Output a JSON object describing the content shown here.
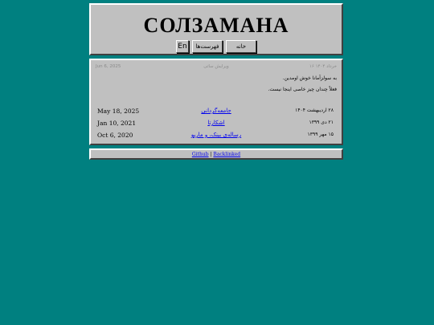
{
  "header": {
    "title": "СОЛЗАМАНА",
    "nav": {
      "lang_label": "En",
      "lists_label": "فهرست‌ها",
      "home_label": "خانه"
    }
  },
  "content": {
    "meta": {
      "date_en": "Jun 6, 2025",
      "edited_label": "ویرایش ساتی",
      "date_fa": "۱۶ خرداد ۱۴۰۴"
    },
    "intro": [
      "به سولزآمانا خوش اومدین.",
      "فعلاً چندان چیز خاصی اینجا نیست."
    ],
    "posts": [
      {
        "date_en": "May 18, 2025",
        "title": "جامعه‌گردانی",
        "date_fa": "۲۸ اردیبهشت ۱۴۰۴"
      },
      {
        "date_en": "Jan 10, 2021",
        "title": "اشکارتا",
        "date_fa": "۲۱ دی ۱۳۹۹"
      },
      {
        "date_en": "Oct 6, 2020",
        "title": "رساله‌ی بینک، و ماریو",
        "date_fa": "۱۵ مهر ۱۳۹۹"
      }
    ]
  },
  "footer": {
    "github_label": "Github",
    "separator": "|",
    "backlinks_label": "Backlinked"
  }
}
